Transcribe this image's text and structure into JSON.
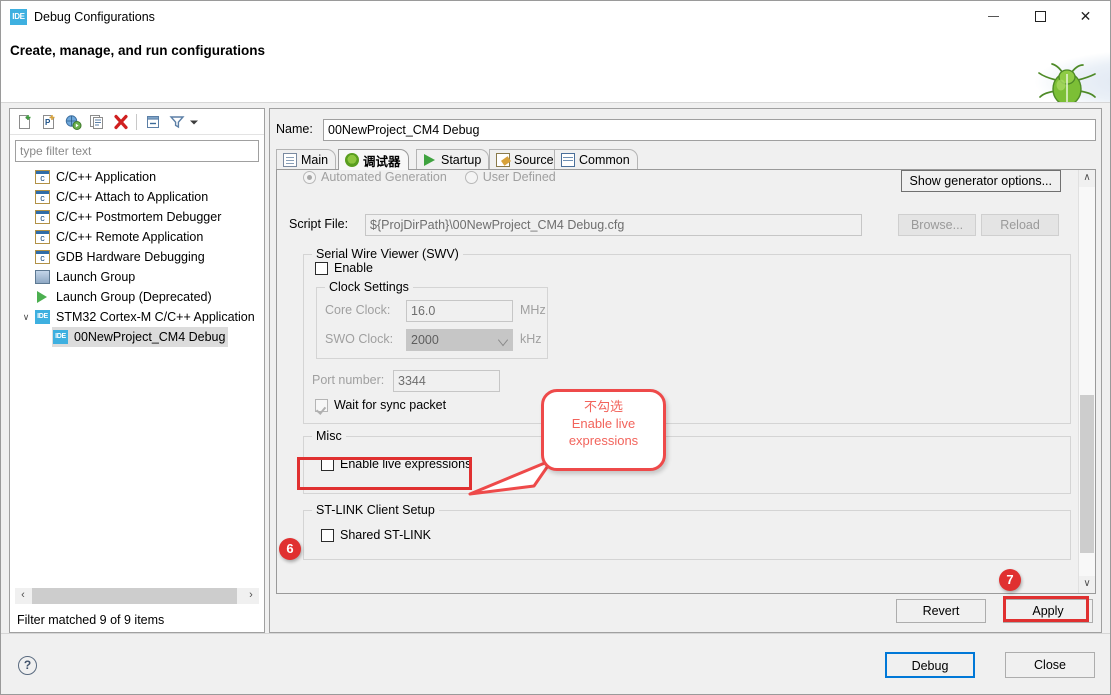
{
  "window": {
    "app_icon": "IDE",
    "title": "Debug Configurations",
    "banner_title": "Create, manage, and run configurations",
    "minimize_label": "Minimize",
    "maximize_label": "Maximize",
    "close_label": "Close",
    "bug_icon": "green-bug-icon"
  },
  "left_panel": {
    "toolbar": [
      {
        "name": "new-launch-configuration-icon",
        "label": "New launch configuration"
      },
      {
        "name": "new-prototype-icon",
        "label": "New launch configuration prototype"
      },
      {
        "name": "export-icon",
        "label": "Export launch configurations"
      },
      {
        "name": "duplicate-icon",
        "label": "Duplicate currently selected launch configuration"
      },
      {
        "name": "delete-icon",
        "label": "Delete selected launch configuration(s)"
      },
      {
        "name": "collapse-all-icon",
        "label": "Collapse All"
      },
      {
        "name": "filter-icon",
        "label": "Filter launch configurations"
      },
      {
        "name": "view-menu-icon",
        "label": "View Menu"
      }
    ],
    "filter": {
      "placeholder": "type filter text",
      "value": ""
    },
    "tree": [
      {
        "label": "C/C++ Application",
        "icon": "c-app-icon",
        "indent": 0,
        "selected": false,
        "twisty": ""
      },
      {
        "label": "C/C++ Attach to Application",
        "icon": "c-app-icon",
        "indent": 0,
        "selected": false,
        "twisty": ""
      },
      {
        "label": "C/C++ Postmortem Debugger",
        "icon": "c-app-icon",
        "indent": 0,
        "selected": false,
        "twisty": ""
      },
      {
        "label": "C/C++ Remote Application",
        "icon": "c-app-icon",
        "indent": 0,
        "selected": false,
        "twisty": ""
      },
      {
        "label": "GDB Hardware Debugging",
        "icon": "c-app-icon",
        "indent": 0,
        "selected": false,
        "twisty": ""
      },
      {
        "label": "Launch Group",
        "icon": "launch-group-icon",
        "indent": 0,
        "selected": false,
        "twisty": ""
      },
      {
        "label": "Launch Group (Deprecated)",
        "icon": "launch-group-deprecated-icon",
        "indent": 0,
        "selected": false,
        "twisty": ""
      },
      {
        "label": "STM32 Cortex-M C/C++ Application",
        "icon": "ide-icon",
        "indent": 0,
        "selected": false,
        "twisty": "∨"
      },
      {
        "label": "00NewProject_CM4 Debug",
        "icon": "ide-icon",
        "indent": 1,
        "selected": true,
        "twisty": ""
      }
    ],
    "hscroll": {
      "left_arrow": "‹",
      "right_arrow": "›"
    },
    "status": "Filter matched 9 of 9 items"
  },
  "right_panel": {
    "name_label": "Name:",
    "name_value": "00NewProject_CM4 Debug",
    "tabs": [
      {
        "label": "Main",
        "icon": "document-icon",
        "active": false
      },
      {
        "label": "调试器",
        "icon": "debugger-bug-icon",
        "active": true
      },
      {
        "label": "Startup",
        "icon": "green-play-icon",
        "active": false
      },
      {
        "label": "Source",
        "icon": "source-pencil-icon",
        "active": false
      },
      {
        "label": "Common",
        "icon": "common-window-icon",
        "active": false
      }
    ],
    "generation": {
      "automated_label": "Automated Generation",
      "user_defined_label": "User Defined",
      "selected": "Automated Generation",
      "show_generator_options_label": "Show generator options..."
    },
    "script": {
      "label": "Script File:",
      "value": "${ProjDirPath}\\00NewProject_CM4 Debug.cfg",
      "browse_label": "Browse...",
      "reload_label": "Reload"
    },
    "swv": {
      "legend": "Serial Wire Viewer (SWV)",
      "enable_label": "Enable",
      "enable_checked": false,
      "clock_settings": {
        "legend": "Clock Settings",
        "core_clock_label": "Core Clock:",
        "core_clock_value": "16.0",
        "core_clock_unit": "MHz",
        "swo_clock_label": "SWO Clock:",
        "swo_clock_value": "2000",
        "swo_clock_unit": "kHz"
      },
      "port_label": "Port number:",
      "port_value": "3344",
      "wait_sync_label": "Wait for sync packet",
      "wait_sync_checked": true
    },
    "misc": {
      "legend": "Misc",
      "enable_live_expressions_label": "Enable live expressions",
      "enable_live_expressions_checked": false
    },
    "stlink": {
      "legend": "ST-LINK Client Setup",
      "shared_label": "Shared ST-LINK",
      "shared_checked": false
    },
    "scrollbar": {
      "up_arrow": "∧",
      "down_arrow": "∨"
    },
    "revert_label": "Revert",
    "apply_label": "Apply"
  },
  "footer": {
    "help_icon": "question-mark-icon",
    "help_glyph": "?",
    "debug_label": "Debug",
    "close_label": "Close"
  },
  "annotations": {
    "badge_6": "6",
    "badge_7": "7",
    "callout_line1": "不勾选",
    "callout_line2": "Enable live",
    "callout_line3": "expressions",
    "accent_red": "#E03030",
    "callout_red": "#F2645C",
    "highlight_blue": "#0078D7"
  }
}
